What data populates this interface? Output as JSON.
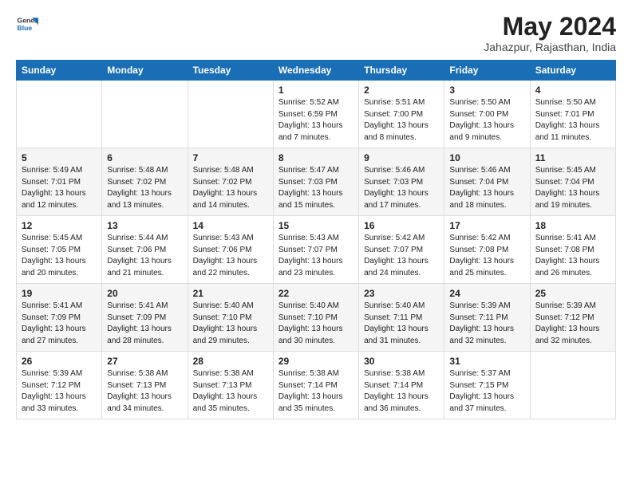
{
  "logo": {
    "line1": "General",
    "line2": "Blue"
  },
  "title": "May 2024",
  "location": "Jahazpur, Rajasthan, India",
  "days_of_week": [
    "Sunday",
    "Monday",
    "Tuesday",
    "Wednesday",
    "Thursday",
    "Friday",
    "Saturday"
  ],
  "weeks": [
    [
      {
        "day": "",
        "sunrise": "",
        "sunset": "",
        "daylight": ""
      },
      {
        "day": "",
        "sunrise": "",
        "sunset": "",
        "daylight": ""
      },
      {
        "day": "",
        "sunrise": "",
        "sunset": "",
        "daylight": ""
      },
      {
        "day": "1",
        "sunrise": "Sunrise: 5:52 AM",
        "sunset": "Sunset: 6:59 PM",
        "daylight": "Daylight: 13 hours and 7 minutes."
      },
      {
        "day": "2",
        "sunrise": "Sunrise: 5:51 AM",
        "sunset": "Sunset: 7:00 PM",
        "daylight": "Daylight: 13 hours and 8 minutes."
      },
      {
        "day": "3",
        "sunrise": "Sunrise: 5:50 AM",
        "sunset": "Sunset: 7:00 PM",
        "daylight": "Daylight: 13 hours and 9 minutes."
      },
      {
        "day": "4",
        "sunrise": "Sunrise: 5:50 AM",
        "sunset": "Sunset: 7:01 PM",
        "daylight": "Daylight: 13 hours and 11 minutes."
      }
    ],
    [
      {
        "day": "5",
        "sunrise": "Sunrise: 5:49 AM",
        "sunset": "Sunset: 7:01 PM",
        "daylight": "Daylight: 13 hours and 12 minutes."
      },
      {
        "day": "6",
        "sunrise": "Sunrise: 5:48 AM",
        "sunset": "Sunset: 7:02 PM",
        "daylight": "Daylight: 13 hours and 13 minutes."
      },
      {
        "day": "7",
        "sunrise": "Sunrise: 5:48 AM",
        "sunset": "Sunset: 7:02 PM",
        "daylight": "Daylight: 13 hours and 14 minutes."
      },
      {
        "day": "8",
        "sunrise": "Sunrise: 5:47 AM",
        "sunset": "Sunset: 7:03 PM",
        "daylight": "Daylight: 13 hours and 15 minutes."
      },
      {
        "day": "9",
        "sunrise": "Sunrise: 5:46 AM",
        "sunset": "Sunset: 7:03 PM",
        "daylight": "Daylight: 13 hours and 17 minutes."
      },
      {
        "day": "10",
        "sunrise": "Sunrise: 5:46 AM",
        "sunset": "Sunset: 7:04 PM",
        "daylight": "Daylight: 13 hours and 18 minutes."
      },
      {
        "day": "11",
        "sunrise": "Sunrise: 5:45 AM",
        "sunset": "Sunset: 7:04 PM",
        "daylight": "Daylight: 13 hours and 19 minutes."
      }
    ],
    [
      {
        "day": "12",
        "sunrise": "Sunrise: 5:45 AM",
        "sunset": "Sunset: 7:05 PM",
        "daylight": "Daylight: 13 hours and 20 minutes."
      },
      {
        "day": "13",
        "sunrise": "Sunrise: 5:44 AM",
        "sunset": "Sunset: 7:06 PM",
        "daylight": "Daylight: 13 hours and 21 minutes."
      },
      {
        "day": "14",
        "sunrise": "Sunrise: 5:43 AM",
        "sunset": "Sunset: 7:06 PM",
        "daylight": "Daylight: 13 hours and 22 minutes."
      },
      {
        "day": "15",
        "sunrise": "Sunrise: 5:43 AM",
        "sunset": "Sunset: 7:07 PM",
        "daylight": "Daylight: 13 hours and 23 minutes."
      },
      {
        "day": "16",
        "sunrise": "Sunrise: 5:42 AM",
        "sunset": "Sunset: 7:07 PM",
        "daylight": "Daylight: 13 hours and 24 minutes."
      },
      {
        "day": "17",
        "sunrise": "Sunrise: 5:42 AM",
        "sunset": "Sunset: 7:08 PM",
        "daylight": "Daylight: 13 hours and 25 minutes."
      },
      {
        "day": "18",
        "sunrise": "Sunrise: 5:41 AM",
        "sunset": "Sunset: 7:08 PM",
        "daylight": "Daylight: 13 hours and 26 minutes."
      }
    ],
    [
      {
        "day": "19",
        "sunrise": "Sunrise: 5:41 AM",
        "sunset": "Sunset: 7:09 PM",
        "daylight": "Daylight: 13 hours and 27 minutes."
      },
      {
        "day": "20",
        "sunrise": "Sunrise: 5:41 AM",
        "sunset": "Sunset: 7:09 PM",
        "daylight": "Daylight: 13 hours and 28 minutes."
      },
      {
        "day": "21",
        "sunrise": "Sunrise: 5:40 AM",
        "sunset": "Sunset: 7:10 PM",
        "daylight": "Daylight: 13 hours and 29 minutes."
      },
      {
        "day": "22",
        "sunrise": "Sunrise: 5:40 AM",
        "sunset": "Sunset: 7:10 PM",
        "daylight": "Daylight: 13 hours and 30 minutes."
      },
      {
        "day": "23",
        "sunrise": "Sunrise: 5:40 AM",
        "sunset": "Sunset: 7:11 PM",
        "daylight": "Daylight: 13 hours and 31 minutes."
      },
      {
        "day": "24",
        "sunrise": "Sunrise: 5:39 AM",
        "sunset": "Sunset: 7:11 PM",
        "daylight": "Daylight: 13 hours and 32 minutes."
      },
      {
        "day": "25",
        "sunrise": "Sunrise: 5:39 AM",
        "sunset": "Sunset: 7:12 PM",
        "daylight": "Daylight: 13 hours and 32 minutes."
      }
    ],
    [
      {
        "day": "26",
        "sunrise": "Sunrise: 5:39 AM",
        "sunset": "Sunset: 7:12 PM",
        "daylight": "Daylight: 13 hours and 33 minutes."
      },
      {
        "day": "27",
        "sunrise": "Sunrise: 5:38 AM",
        "sunset": "Sunset: 7:13 PM",
        "daylight": "Daylight: 13 hours and 34 minutes."
      },
      {
        "day": "28",
        "sunrise": "Sunrise: 5:38 AM",
        "sunset": "Sunset: 7:13 PM",
        "daylight": "Daylight: 13 hours and 35 minutes."
      },
      {
        "day": "29",
        "sunrise": "Sunrise: 5:38 AM",
        "sunset": "Sunset: 7:14 PM",
        "daylight": "Daylight: 13 hours and 35 minutes."
      },
      {
        "day": "30",
        "sunrise": "Sunrise: 5:38 AM",
        "sunset": "Sunset: 7:14 PM",
        "daylight": "Daylight: 13 hours and 36 minutes."
      },
      {
        "day": "31",
        "sunrise": "Sunrise: 5:37 AM",
        "sunset": "Sunset: 7:15 PM",
        "daylight": "Daylight: 13 hours and 37 minutes."
      },
      {
        "day": "",
        "sunrise": "",
        "sunset": "",
        "daylight": ""
      }
    ]
  ],
  "colors": {
    "header_bg": "#1a6eb5",
    "header_text": "#ffffff",
    "row_even_bg": "#f5f5f5",
    "row_odd_bg": "#ffffff"
  }
}
